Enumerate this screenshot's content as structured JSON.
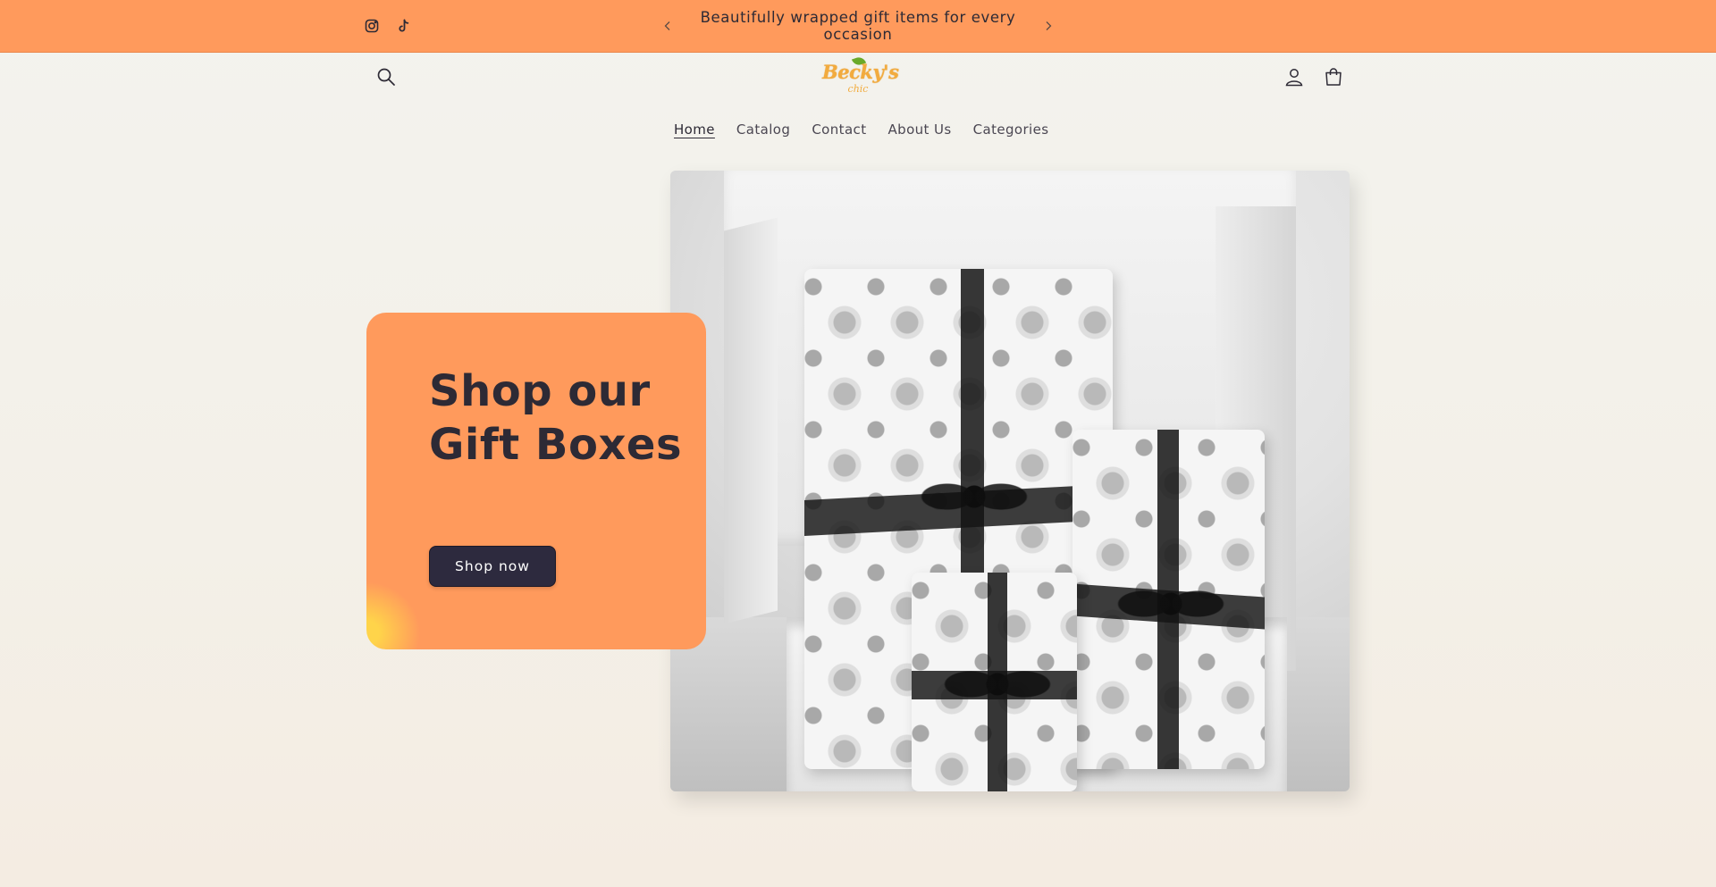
{
  "announcement": {
    "text": "Beautifully wrapped gift items for every occasion",
    "social": [
      {
        "icon": "instagram-icon"
      },
      {
        "icon": "tiktok-icon"
      }
    ],
    "prev_icon": "chevron-left-icon",
    "next_icon": "chevron-right-icon"
  },
  "header": {
    "logo_text": "Becky's",
    "logo_sub": "chic",
    "search_icon": "search-icon",
    "account_icon": "account-icon",
    "cart_icon": "cart-icon"
  },
  "nav": {
    "items": [
      {
        "label": "Home",
        "active": true
      },
      {
        "label": "Catalog",
        "active": false
      },
      {
        "label": "Contact",
        "active": false
      },
      {
        "label": "About Us",
        "active": false
      },
      {
        "label": "Categories",
        "active": false
      }
    ]
  },
  "hero": {
    "title": "Shop our Gift Boxes",
    "button_label": "Shop now"
  },
  "colors": {
    "accent": "#ff9a5c",
    "button": "#2d2a3e",
    "text": "#2d2a35",
    "logo": "#f2ab3e"
  }
}
